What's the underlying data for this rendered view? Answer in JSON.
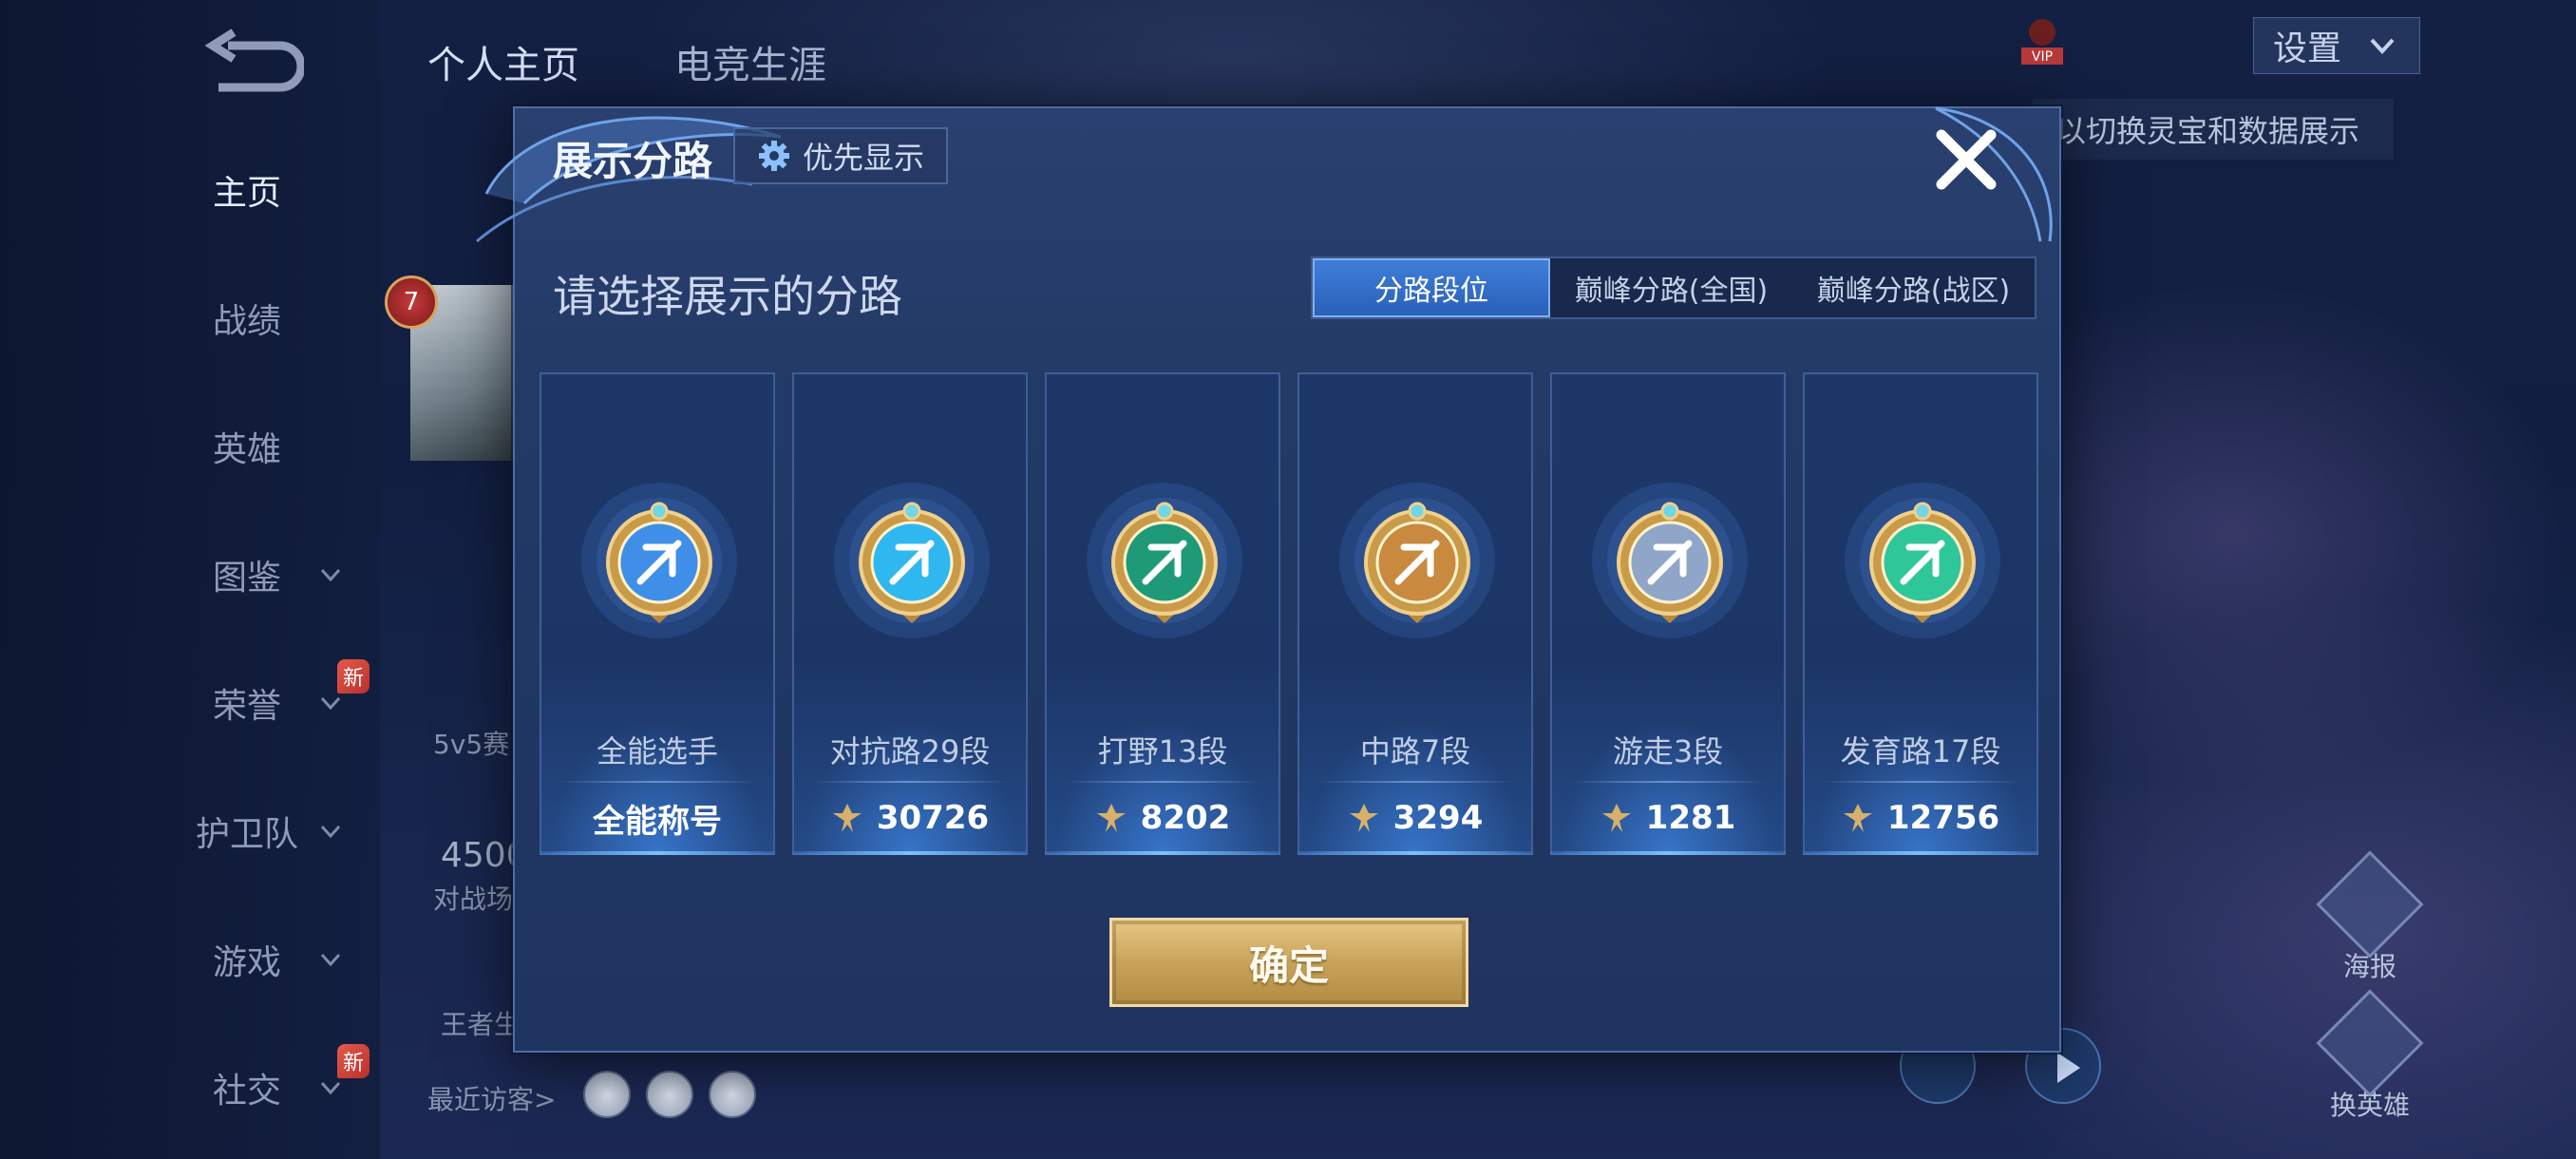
{
  "nav": {
    "items": [
      {
        "label": "主页",
        "active": true,
        "chevron": false,
        "new": false
      },
      {
        "label": "战绩",
        "active": false,
        "chevron": false,
        "new": false
      },
      {
        "label": "英雄",
        "active": false,
        "chevron": false,
        "new": false
      },
      {
        "label": "图鉴",
        "active": false,
        "chevron": true,
        "new": false
      },
      {
        "label": "荣誉",
        "active": false,
        "chevron": true,
        "new": true
      },
      {
        "label": "护卫队",
        "active": false,
        "chevron": true,
        "new": false
      },
      {
        "label": "游戏",
        "active": false,
        "chevron": true,
        "new": false
      },
      {
        "label": "社交",
        "active": false,
        "chevron": true,
        "new": true
      }
    ],
    "new_badge": "新"
  },
  "top_tabs": [
    {
      "label": "个人主页",
      "active": true
    },
    {
      "label": "电竞生涯",
      "active": false
    }
  ],
  "profile": {
    "level": "7",
    "mode_text": "5v5赛",
    "stat_number": "4500",
    "stat_label": "对战场",
    "king_text": "王者生",
    "recent_visitors_label": "最近访客>"
  },
  "header_right": {
    "settings_label": "设置",
    "vip_label": "VIP",
    "tip_text": "以切换灵宝和数据展示"
  },
  "side_actions": [
    {
      "label": "海报",
      "icon": "poster-icon"
    },
    {
      "label": "换英雄",
      "icon": "switch-hero-icon"
    }
  ],
  "modal": {
    "title": "展示分路",
    "priority_label": "优先显示",
    "subtitle": "请选择展示的分路",
    "tabs": [
      {
        "label": "分路段位",
        "active": true
      },
      {
        "label": "巅峰分路(全国)",
        "active": false
      },
      {
        "label": "巅峰分路(战区)",
        "active": false
      }
    ],
    "cards": [
      {
        "name": "全能选手",
        "score": "全能称号",
        "has_points_icon": false,
        "emblem": "all-round-emblem-icon",
        "color": "#3f8fe8"
      },
      {
        "name": "对抗路29段",
        "score": "30726",
        "has_points_icon": true,
        "emblem": "clash-lane-emblem-icon",
        "color": "#2fb8f0"
      },
      {
        "name": "打野13段",
        "score": "8202",
        "has_points_icon": true,
        "emblem": "jungle-emblem-icon",
        "color": "#1f9a78"
      },
      {
        "name": "中路7段",
        "score": "3294",
        "has_points_icon": true,
        "emblem": "mid-lane-emblem-icon",
        "color": "#c9893f"
      },
      {
        "name": "游走3段",
        "score": "1281",
        "has_points_icon": true,
        "emblem": "roam-emblem-icon",
        "color": "#8fa6c8"
      },
      {
        "name": "发育路17段",
        "score": "12756",
        "has_points_icon": true,
        "emblem": "farm-lane-emblem-icon",
        "color": "#2fc79a"
      }
    ],
    "confirm_label": "确定"
  }
}
